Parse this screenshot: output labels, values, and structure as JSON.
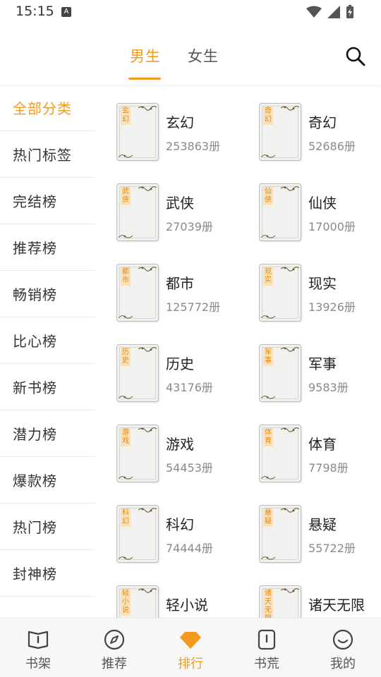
{
  "status_bar": {
    "time": "15:15",
    "notif_icon": "A"
  },
  "header": {
    "tabs": [
      {
        "label": "男生",
        "active": true
      },
      {
        "label": "女生",
        "active": false
      }
    ],
    "search_icon": "search-icon",
    "accent_color": "#f39a1e"
  },
  "sidebar": {
    "items": [
      {
        "label": "全部分类",
        "active": true
      },
      {
        "label": "热门标签"
      },
      {
        "label": "完结榜"
      },
      {
        "label": "推荐榜"
      },
      {
        "label": "畅销榜"
      },
      {
        "label": "比心榜"
      },
      {
        "label": "新书榜"
      },
      {
        "label": "潜力榜"
      },
      {
        "label": "爆款榜"
      },
      {
        "label": "热门榜"
      },
      {
        "label": "封神榜"
      }
    ]
  },
  "categories": [
    {
      "name": "玄幻",
      "count": "253863册",
      "tag": "玄幻"
    },
    {
      "name": "奇幻",
      "count": "52686册",
      "tag": "奇幻"
    },
    {
      "name": "武侠",
      "count": "27039册",
      "tag": "武侠"
    },
    {
      "name": "仙侠",
      "count": "17000册",
      "tag": "仙侠"
    },
    {
      "name": "都市",
      "count": "125772册",
      "tag": "都市"
    },
    {
      "name": "现实",
      "count": "13926册",
      "tag": "现实"
    },
    {
      "name": "历史",
      "count": "43176册",
      "tag": "历史"
    },
    {
      "name": "军事",
      "count": "9583册",
      "tag": "军事"
    },
    {
      "name": "游戏",
      "count": "54453册",
      "tag": "游戏"
    },
    {
      "name": "体育",
      "count": "7798册",
      "tag": "体育"
    },
    {
      "name": "科幻",
      "count": "74444册",
      "tag": "科幻"
    },
    {
      "name": "悬疑",
      "count": "55722册",
      "tag": "悬疑"
    },
    {
      "name": "轻小说",
      "count": "",
      "tag": "轻小说"
    },
    {
      "name": "诸天无限",
      "count": "",
      "tag": "诸天无限"
    }
  ],
  "bottom_nav": [
    {
      "label": "书架",
      "icon": "bookshelf-icon",
      "active": false
    },
    {
      "label": "推荐",
      "icon": "compass-icon",
      "active": false
    },
    {
      "label": "排行",
      "icon": "diamond-icon",
      "active": true
    },
    {
      "label": "书荒",
      "icon": "book-alert-icon",
      "active": false
    },
    {
      "label": "我的",
      "icon": "smiley-icon",
      "active": false
    }
  ]
}
